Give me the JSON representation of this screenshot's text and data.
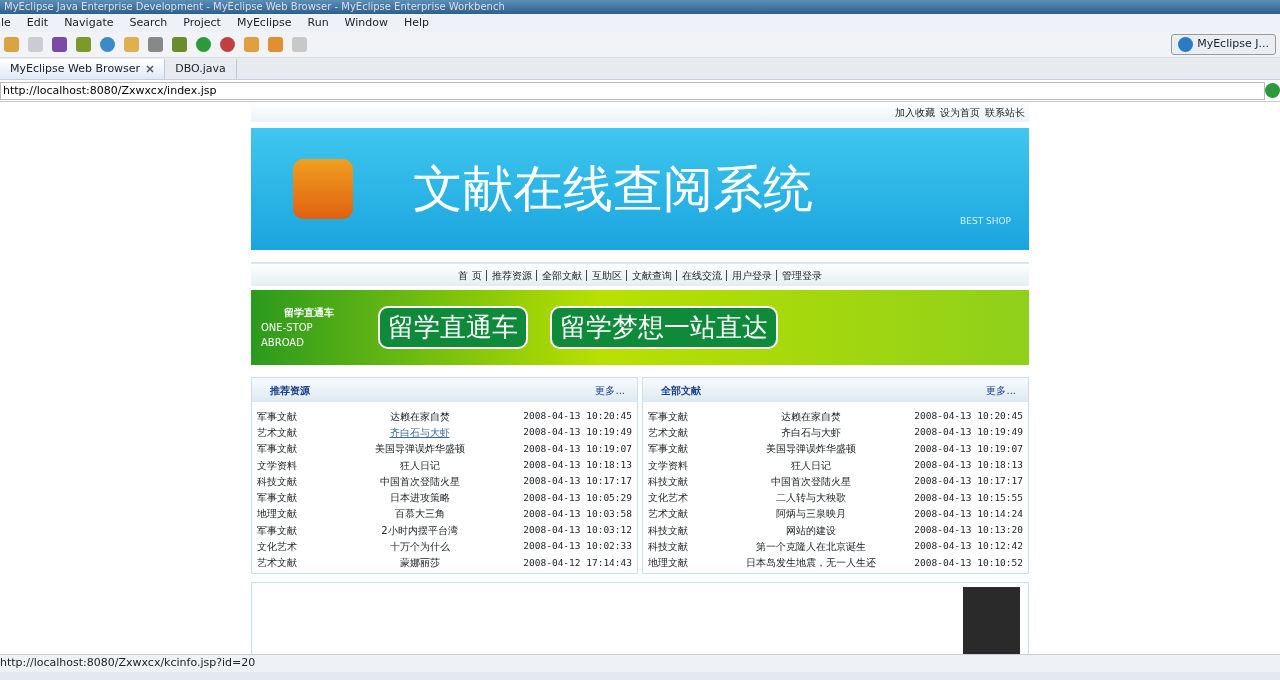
{
  "window": {
    "title": "MyEclipse Java Enterprise Development - MyEclipse Web Browser - MyEclipse Enterprise Workbench"
  },
  "menu": [
    "le",
    "Edit",
    "Navigate",
    "Search",
    "Project",
    "MyEclipse",
    "Run",
    "Window",
    "Help"
  ],
  "perspective": {
    "label": "MyEclipse J..."
  },
  "tabs": [
    {
      "label": "MyEclipse Web Browser",
      "selected": true,
      "closable": true
    },
    {
      "label": "DBO.java",
      "selected": false,
      "closable": false
    }
  ],
  "address": {
    "value": "http://localhost:8080/Zxwxcx/index.jsp"
  },
  "page": {
    "top_links": [
      "加入收藏",
      "设为首页",
      "联系站长"
    ],
    "header": {
      "title": "文献在线查阅系统",
      "badge": "BEST SHOP"
    },
    "nav": [
      "首 页",
      "推荐资源",
      "全部文献",
      "互助区",
      "文献查询",
      "在线交流",
      "用户登录",
      "管理登录"
    ],
    "ad": {
      "logo": "留学直通车",
      "logo_sub": "ONE-STOP ABROAD",
      "slogans": [
        "留学直通车",
        "留学梦想一站直达"
      ]
    },
    "panels": [
      {
        "title": "推荐资源",
        "more": "更多...",
        "rows": [
          {
            "category": "军事文献",
            "title": "达赖在家自焚",
            "date": "2008-04-13 10:20:45",
            "hovered": false
          },
          {
            "category": "艺术文献",
            "title": "齐白石与大虾",
            "date": "2008-04-13 10:19:49",
            "hovered": true
          },
          {
            "category": "军事文献",
            "title": "美国导弹误炸华盛顿",
            "date": "2008-04-13 10:19:07",
            "hovered": false
          },
          {
            "category": "文学资料",
            "title": "狂人日记",
            "date": "2008-04-13 10:18:13",
            "hovered": false
          },
          {
            "category": "科技文献",
            "title": "中国首次登陆火星",
            "date": "2008-04-13 10:17:17",
            "hovered": false
          },
          {
            "category": "军事文献",
            "title": "日本进攻策略",
            "date": "2008-04-13 10:05:29",
            "hovered": false
          },
          {
            "category": "地理文献",
            "title": "百慕大三角",
            "date": "2008-04-13 10:03:58",
            "hovered": false
          },
          {
            "category": "军事文献",
            "title": "2小时内摆平台湾",
            "date": "2008-04-13 10:03:12",
            "hovered": false
          },
          {
            "category": "文化艺术",
            "title": "十万个为什么",
            "date": "2008-04-13 10:02:33",
            "hovered": false
          },
          {
            "category": "艺术文献",
            "title": "蒙娜丽莎",
            "date": "2008-04-12 17:14:43",
            "hovered": false
          }
        ]
      },
      {
        "title": "全部文献",
        "more": "更多...",
        "rows": [
          {
            "category": "军事文献",
            "title": "达赖在家自焚",
            "date": "2008-04-13 10:20:45",
            "hovered": false
          },
          {
            "category": "艺术文献",
            "title": "齐白石与大虾",
            "date": "2008-04-13 10:19:49",
            "hovered": false
          },
          {
            "category": "军事文献",
            "title": "美国导弹误炸华盛顿",
            "date": "2008-04-13 10:19:07",
            "hovered": false
          },
          {
            "category": "文学资料",
            "title": "狂人日记",
            "date": "2008-04-13 10:18:13",
            "hovered": false
          },
          {
            "category": "科技文献",
            "title": "中国首次登陆火星",
            "date": "2008-04-13 10:17:17",
            "hovered": false
          },
          {
            "category": "文化艺术",
            "title": "二人转与大秧歌",
            "date": "2008-04-13 10:15:55",
            "hovered": false
          },
          {
            "category": "艺术文献",
            "title": "阿炳与三泉映月",
            "date": "2008-04-13 10:14:24",
            "hovered": false
          },
          {
            "category": "科技文献",
            "title": "网站的建设",
            "date": "2008-04-13 10:13:20",
            "hovered": false
          },
          {
            "category": "科技文献",
            "title": "第一个克隆人在北京诞生",
            "date": "2008-04-13 10:12:42",
            "hovered": false
          },
          {
            "category": "地理文献",
            "title": "日本岛发生地震，无一人生还",
            "date": "2008-04-13 10:10:52",
            "hovered": false
          }
        ]
      }
    ]
  },
  "status_bar": {
    "text": "http://localhost:8080/Zxwxcx/kcinfo.jsp?id=20"
  }
}
